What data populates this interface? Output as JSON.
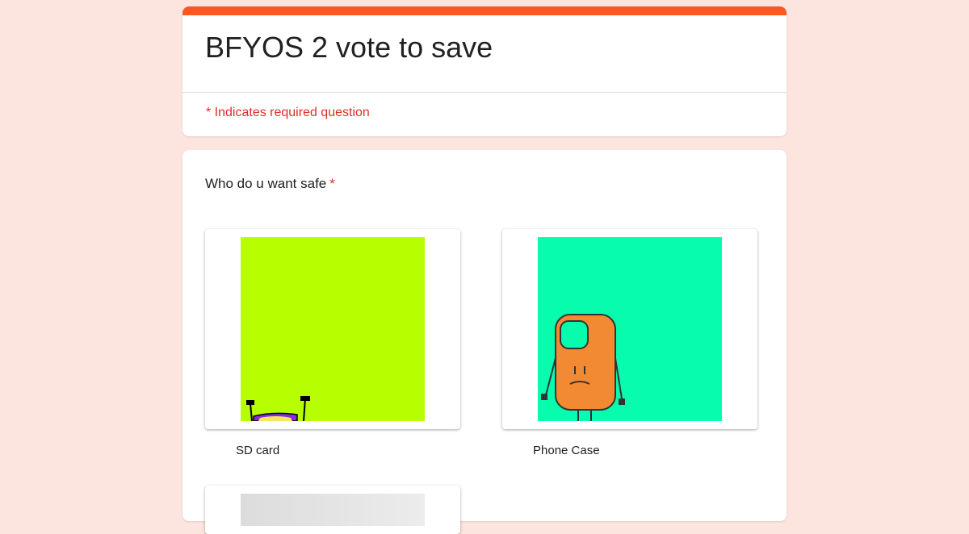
{
  "form": {
    "title": "BFYOS 2 vote to save",
    "required_note": "* Indicates required question",
    "accent_color": "#ff5722",
    "background_color": "#fce5de"
  },
  "question": {
    "title": "Who do u want safe",
    "required_marker": "*",
    "options": [
      {
        "label": "SD card",
        "image_color": "#b7ff00"
      },
      {
        "label": "Phone Case",
        "image_color": "#08fcae"
      }
    ]
  }
}
